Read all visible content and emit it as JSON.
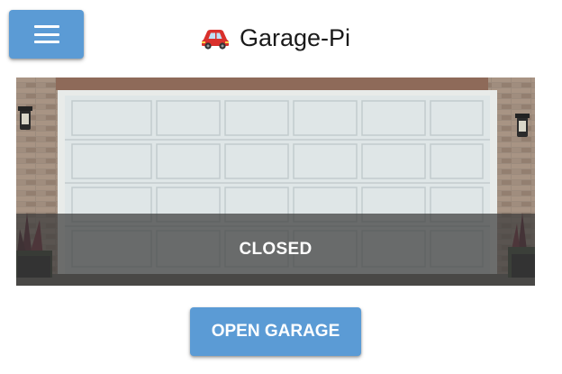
{
  "header": {
    "menu_icon": "hamburger-menu-icon",
    "title_icon": "car-icon",
    "title": "Garage-Pi"
  },
  "garage": {
    "status": "CLOSED"
  },
  "actions": {
    "toggle_label": "OPEN GARAGE"
  },
  "colors": {
    "accent": "#5b9bd5",
    "overlay": "#3c3c3c",
    "car": "#d9302c"
  }
}
